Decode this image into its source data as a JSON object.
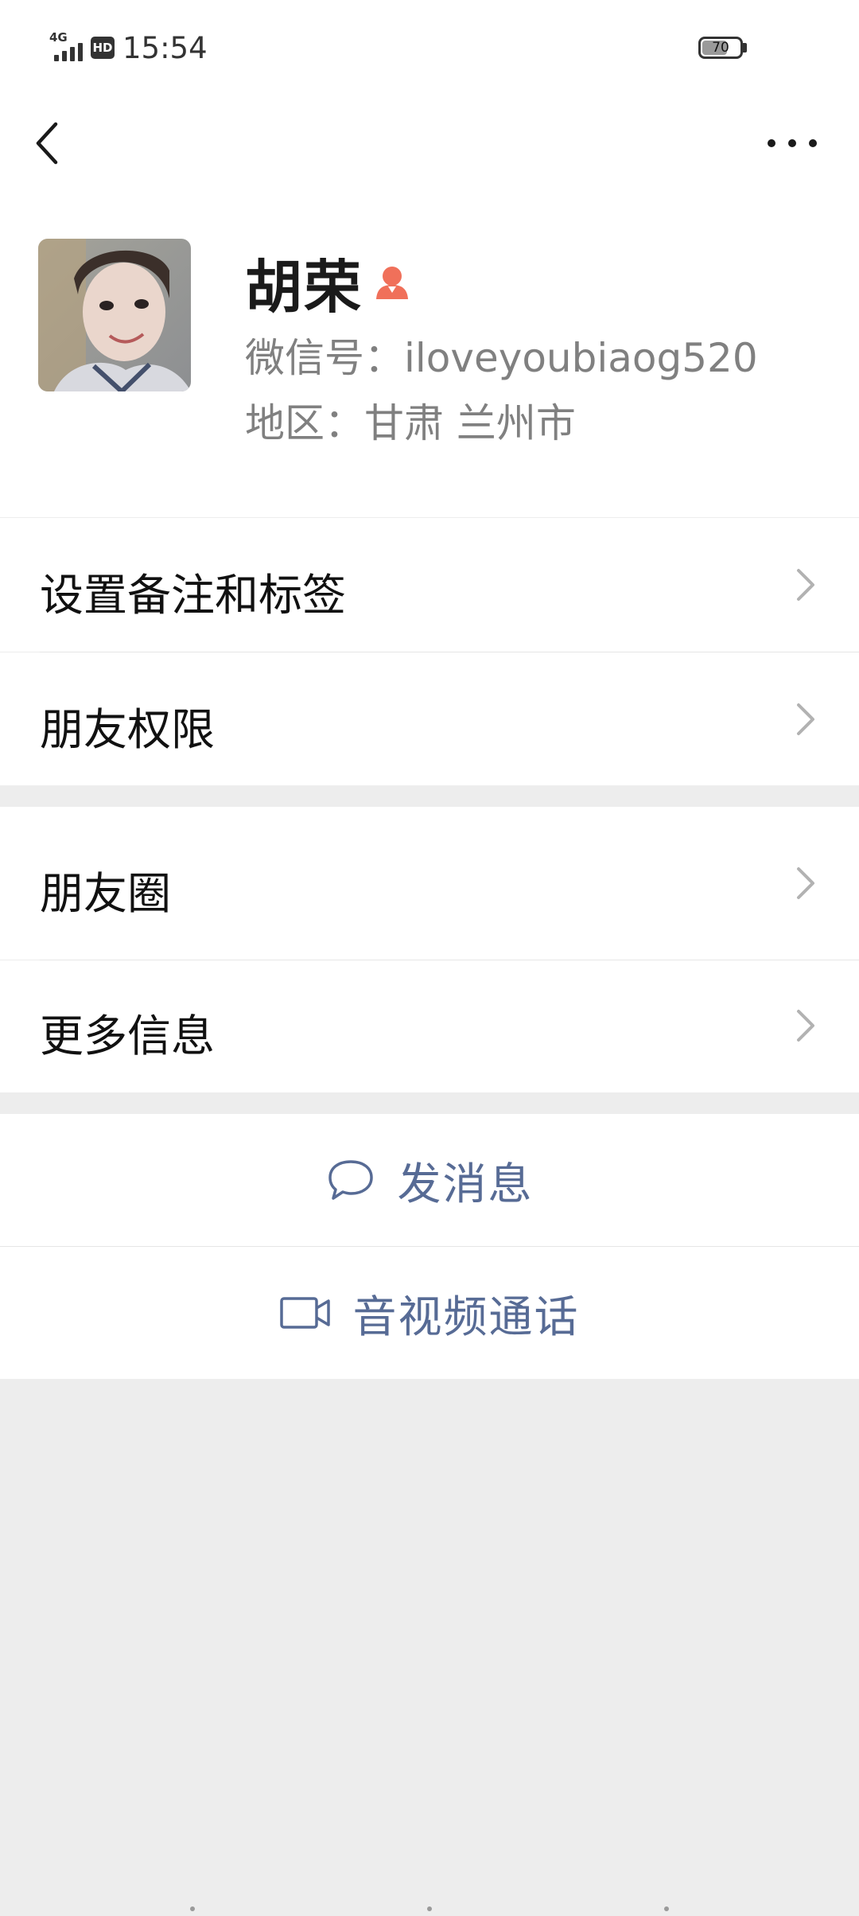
{
  "status_bar": {
    "network": "4G",
    "hd": "HD",
    "time": "15:54",
    "battery_percent": 70,
    "battery_text": "70"
  },
  "nav": {
    "back_icon": "chevron-left-icon",
    "more_icon": "more-horizontal-icon"
  },
  "profile": {
    "name": "胡荣",
    "gender_icon": "female-icon",
    "gender_color": "#f0705a",
    "wechat_id": "微信号：iloveyoubiaog520",
    "region": "地区：甘肃  兰州市"
  },
  "menu": {
    "group1": [
      "设置备注和标签",
      "朋友权限"
    ],
    "group2": [
      "朋友圈",
      "更多信息"
    ]
  },
  "actions": {
    "message": "发消息",
    "call": "音视频通话",
    "link_color": "#576b95"
  }
}
